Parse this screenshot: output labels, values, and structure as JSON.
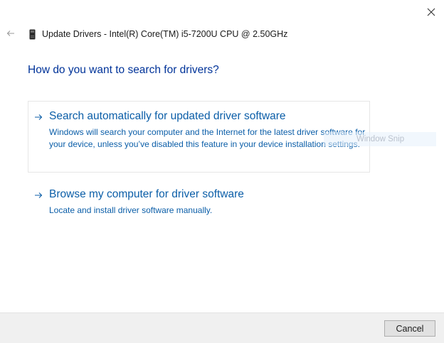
{
  "window": {
    "title": "Update Drivers - Intel(R) Core(TM) i5-7200U CPU @ 2.50GHz",
    "device_icon": "device-icon",
    "back_icon": "back-arrow-icon",
    "close_icon": "close-icon"
  },
  "heading": "How do you want to search for drivers?",
  "options": [
    {
      "title": "Search automatically for updated driver software",
      "description": "Windows will search your computer and the Internet for the latest driver software for your device, unless you’ve disabled this feature in your device installation settings.",
      "icon": "arrow-right-icon"
    },
    {
      "title": "Browse my computer for driver software",
      "description": "Locate and install driver software manually.",
      "icon": "arrow-right-icon"
    }
  ],
  "overlay": {
    "text": "Window Snip"
  },
  "footer": {
    "cancel_label": "Cancel"
  },
  "colors": {
    "link": "#0b5ea8",
    "heading": "#003399",
    "footer_bg": "#f0f0f0",
    "button_bg": "#e1e1e1"
  }
}
